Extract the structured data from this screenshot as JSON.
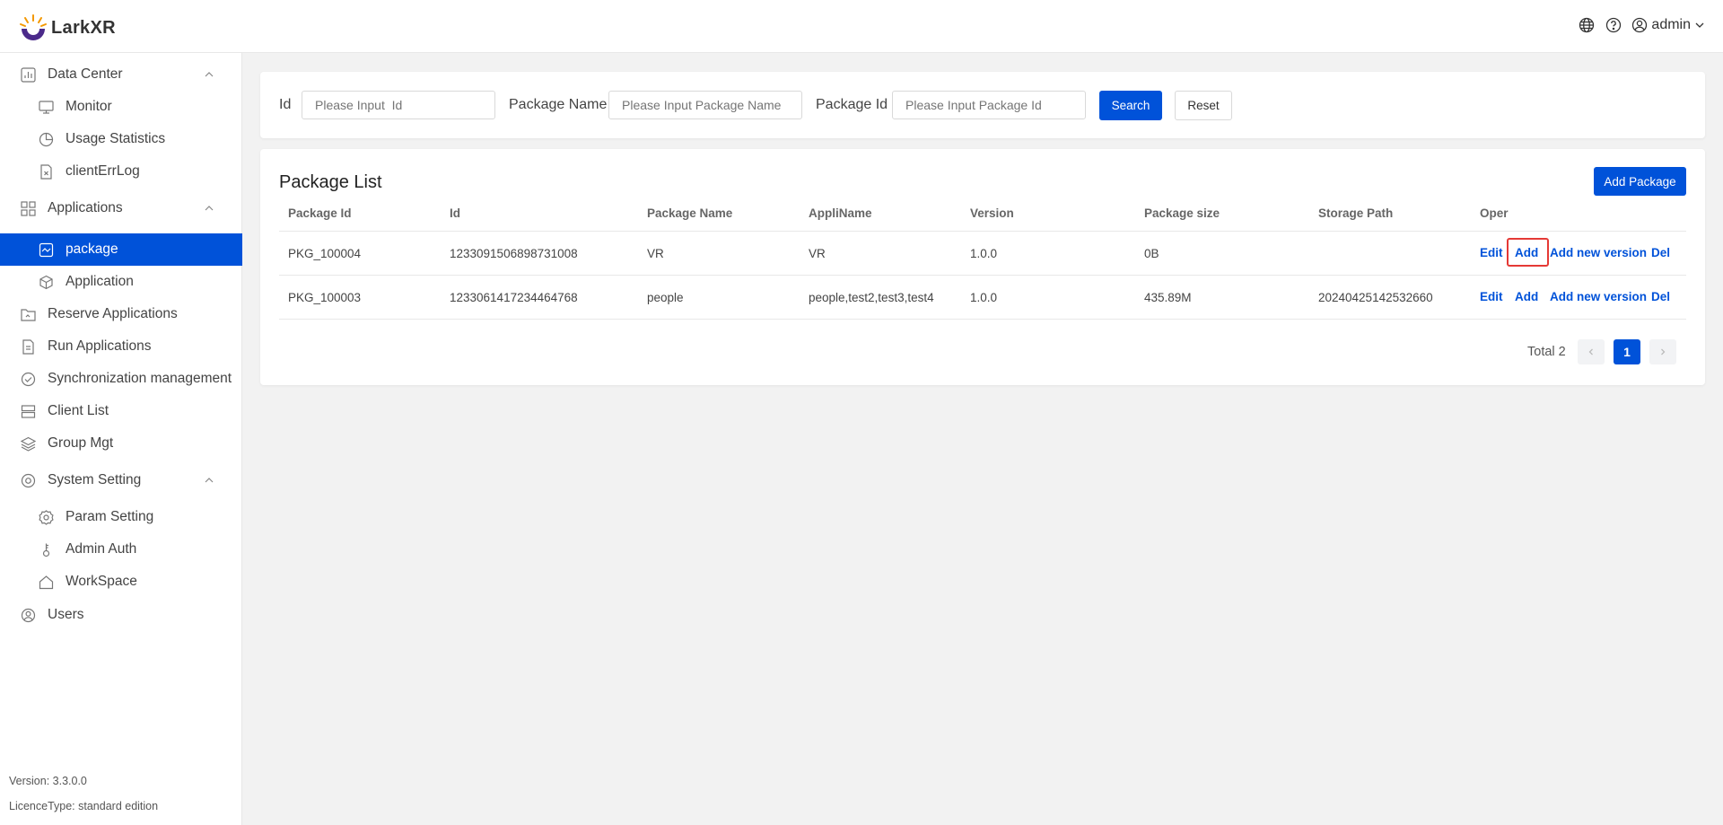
{
  "app": {
    "logo_text": "LarkXR",
    "user_name": "admin"
  },
  "colors": {
    "primary": "#0052d9",
    "highlight": "#e53935"
  },
  "sidebar": {
    "data_center": "Data Center",
    "monitor": "Monitor",
    "usage_statistics": "Usage Statistics",
    "client_err_log": "clientErrLog",
    "applications": "Applications",
    "package": "package",
    "application": "Application",
    "reserve_applications": "Reserve Applications",
    "run_applications": "Run Applications",
    "sync_management": "Synchronization management",
    "client_list": "Client List",
    "group_mgt": "Group Mgt",
    "system_setting": "System Setting",
    "param_setting": "Param Setting",
    "admin_auth": "Admin Auth",
    "workspace": "WorkSpace",
    "users": "Users",
    "version": "Version: 3.3.0.0",
    "licence": "LicenceType: standard edition"
  },
  "search": {
    "id_label": "Id",
    "id_placeholder": "Please Input  Id",
    "name_label": "Package Name",
    "name_placeholder": "Please Input Package Name",
    "pkgid_label": "Package Id",
    "pkgid_placeholder": "Please Input Package Id",
    "search_btn": "Search",
    "reset_btn": "Reset"
  },
  "list": {
    "title": "Package List",
    "add_btn": "Add Package",
    "columns": [
      "Package Id",
      "Id",
      "Package Name",
      "AppliName",
      "Version",
      "Package size",
      "Storage Path",
      "Oper"
    ],
    "rows": [
      {
        "package_id": "PKG_100004",
        "id": "1233091506898731008",
        "name": "VR",
        "appli": "VR",
        "version": "1.0.0",
        "size": "0B",
        "path": ""
      },
      {
        "package_id": "PKG_100003",
        "id": "1233061417234464768",
        "name": "people",
        "appli": "people,test2,test3,test4",
        "version": "1.0.0",
        "size": "435.89M",
        "path": "20240425142532660"
      }
    ],
    "ops": {
      "edit": "Edit",
      "add": "Add",
      "add_version": "Add new version",
      "del": "Del"
    },
    "pagination": {
      "total": "Total 2",
      "current": "1"
    }
  }
}
